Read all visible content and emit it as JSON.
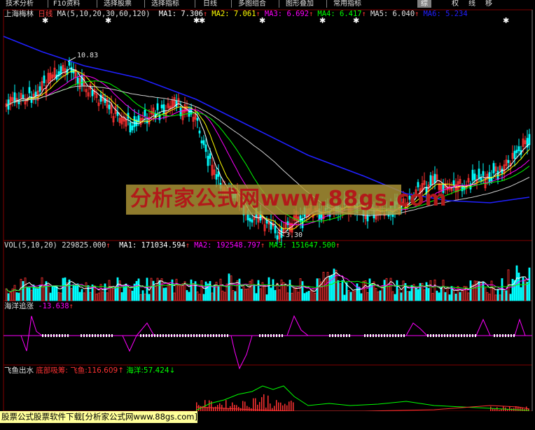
{
  "toolbar": {
    "items": [
      "技术分析",
      "F10资料",
      "选择股票",
      "选择指标",
      "日线",
      "多图组合",
      "图形叠加",
      "常用指标"
    ],
    "right_buttons": [
      "综",
      "权",
      "线",
      "移"
    ]
  },
  "main": {
    "stock_name": "上海梅林",
    "period": "日线",
    "indicator": "MA(5,10,20,30,60,120)",
    "ma": [
      {
        "label": "MA1:",
        "value": "7.306",
        "arrow": "↑",
        "color": "#ffffff"
      },
      {
        "label": "MA2:",
        "value": "7.061",
        "arrow": "↑",
        "color": "#ffff00"
      },
      {
        "label": "MA3:",
        "value": "6.692",
        "arrow": "↑",
        "color": "#ff00ff"
      },
      {
        "label": "MA4:",
        "value": "6.417",
        "arrow": "↑",
        "color": "#00ff00"
      },
      {
        "label": "MA5:",
        "value": "6.040",
        "arrow": "↑",
        "color": "#e0e0e0"
      },
      {
        "label": "MA6:",
        "value": "5.234",
        "arrow": "",
        "color": "#2020ff"
      }
    ],
    "high_label": "10.83",
    "low_label": "3.30"
  },
  "vol": {
    "indicator": "VOL(5,10,20)",
    "value": "229825.000",
    "ma": [
      {
        "label": "MA1:",
        "value": "171034.594",
        "arrow": "↑",
        "color": "#ffffff"
      },
      {
        "label": "MA2:",
        "value": "192548.797",
        "arrow": "↑",
        "color": "#ff00ff"
      },
      {
        "label": "MA3:",
        "value": "151647.500",
        "arrow": "↑",
        "color": "#00ff00"
      }
    ]
  },
  "haiyang": {
    "name": "海洋追涨",
    "value": "-13.638",
    "arrow": "↑"
  },
  "feiyu": {
    "name": "飞鱼出水",
    "bottom_label": "底部吸筹:",
    "feiyu_label": "飞鱼:",
    "feiyu_value": "116.609",
    "feiyu_arrow": "↑",
    "haiyang_label": "海洋:",
    "haiyang_value": "57.424",
    "haiyang_arrow": "↓"
  },
  "watermark": "分析家公式网www.88gs.com",
  "footer": "股票公式股票软件下载[分析家公式网www.88gs.com]",
  "colors": {
    "up": "#ff3232",
    "down": "#00ffff",
    "grid": "#800000",
    "ma_white": "#ffffff",
    "ma_yellow": "#ffff00",
    "ma_magenta": "#ff00ff",
    "ma_green": "#00ff00",
    "ma_blue": "#2020ff"
  }
}
